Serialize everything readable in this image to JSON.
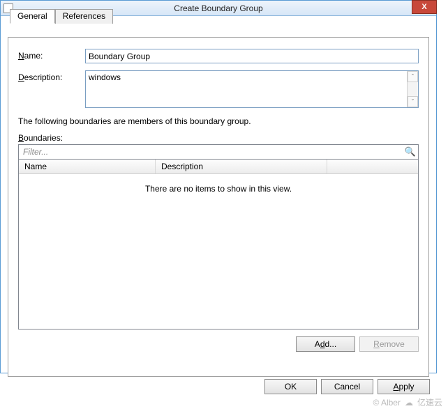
{
  "window": {
    "title": "Create Boundary Group",
    "close_label": "X"
  },
  "tabs": {
    "general": "General",
    "references": "References"
  },
  "fields": {
    "name_label_pre": "N",
    "name_label_rest": "ame:",
    "name_value": "Boundary Group",
    "desc_label_pre": "D",
    "desc_label_rest": "escription:",
    "desc_value": "windows "
  },
  "hint": "The following boundaries are members of this boundary group.",
  "boundaries": {
    "label_pre": "B",
    "label_rest": "oundaries:",
    "filter_placeholder": "Filter...",
    "col_name": "Name",
    "col_desc": "Description",
    "empty": "There are no items to show in this view."
  },
  "buttons": {
    "add_pre": "A",
    "add_und": "d",
    "add_rest": "d...",
    "remove_pre": "",
    "remove_und": "R",
    "remove_rest": "emove",
    "ok": "OK",
    "cancel": "Cancel",
    "apply_pre": "",
    "apply_und": "A",
    "apply_rest": "pply"
  },
  "watermark": {
    "left": "© Alber",
    "right": "亿速云"
  }
}
